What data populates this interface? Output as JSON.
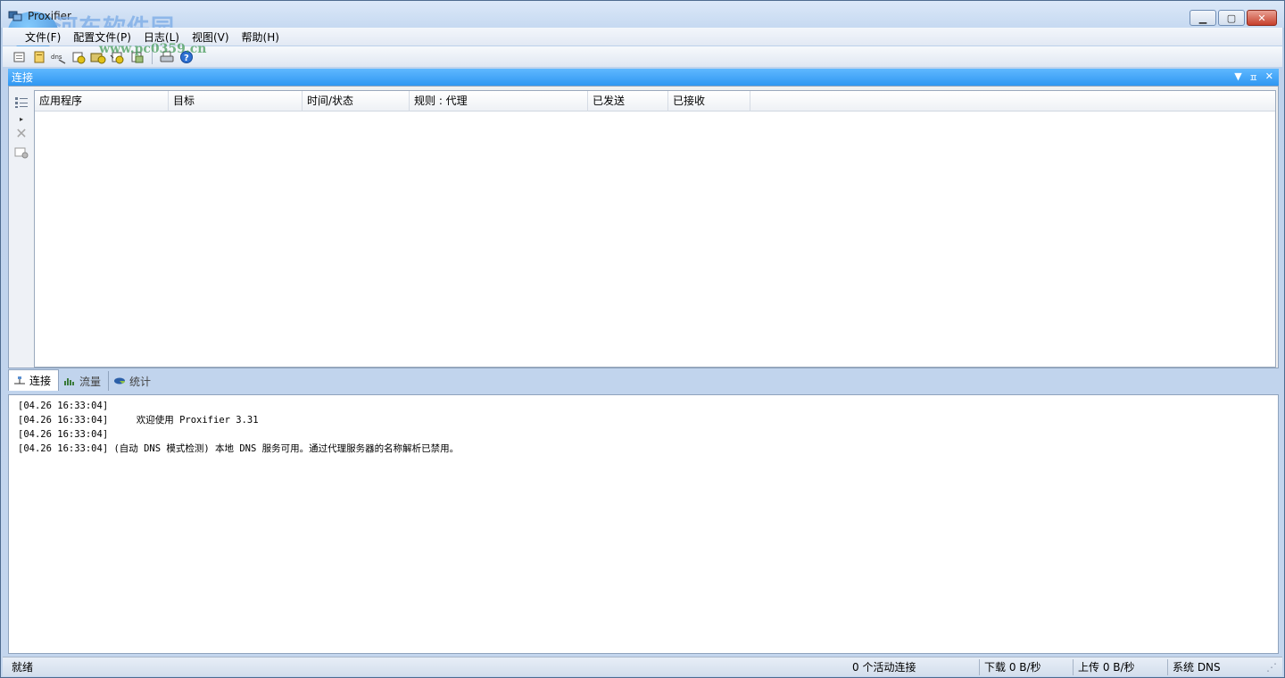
{
  "window": {
    "title": "Proxifier",
    "watermark_text": "河东软件园",
    "watermark_url": "www.pc0359.cn"
  },
  "menu": {
    "items": [
      {
        "label": "文件(F)"
      },
      {
        "label": "配置文件(P)"
      },
      {
        "label": "日志(L)"
      },
      {
        "label": "视图(V)"
      },
      {
        "label": "帮助(H)"
      }
    ]
  },
  "toolbar": {
    "icons": [
      "new-profile-icon",
      "open-profile-icon",
      "dns-icon",
      "proxy-servers-icon",
      "proxification-rules-icon",
      "name-resolution-icon",
      "advanced-icon",
      "print-icon",
      "help-icon"
    ]
  },
  "panel": {
    "title": "连接"
  },
  "connections": {
    "columns": [
      {
        "label": "应用程序"
      },
      {
        "label": "目标"
      },
      {
        "label": "时间/状态"
      },
      {
        "label": "规则 : 代理"
      },
      {
        "label": "已发送"
      },
      {
        "label": "已接收"
      }
    ],
    "rows": []
  },
  "tabs": [
    {
      "label": "连接",
      "icon": "connection-icon",
      "active": true
    },
    {
      "label": "流量",
      "icon": "traffic-icon",
      "active": false
    },
    {
      "label": "统计",
      "icon": "statistics-icon",
      "active": false
    }
  ],
  "log": {
    "lines": [
      "[04.26 16:33:04]",
      "[04.26 16:33:04]     欢迎使用 Proxifier 3.31",
      "[04.26 16:33:04]",
      "[04.26 16:33:04] (自动 DNS 模式检测) 本地 DNS 服务可用。通过代理服务器的名称解析已禁用。"
    ]
  },
  "status": {
    "ready": "就绪",
    "active_connections": "0 个活动连接",
    "download": "下载 0 B/秒",
    "upload": "上传 0 B/秒",
    "dns": "系统 DNS"
  },
  "colors": {
    "panel_header": "#2f97f2",
    "titlebar": "#c6d9f1"
  }
}
